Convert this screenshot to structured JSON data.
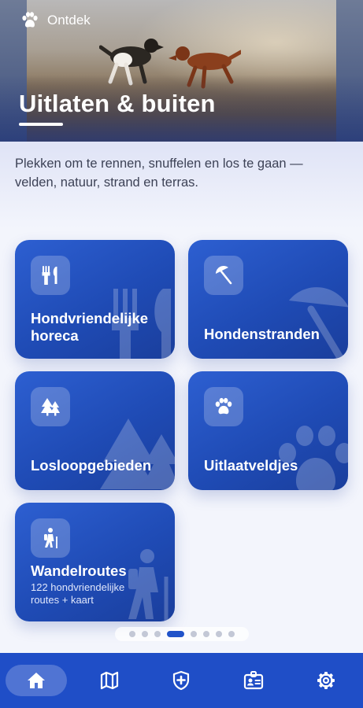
{
  "header": {
    "brand_label": "Ontdek",
    "title": "Uitlaten & buiten",
    "brand_icon": "paw-icon"
  },
  "intro": {
    "text": "Plekken om te rennen, snuffelen en los te gaan — velden, natuur, strand en terras."
  },
  "categories": [
    {
      "label": "Hondvriendelijke horeca",
      "icon": "utensils-icon"
    },
    {
      "label": "Hondenstranden",
      "icon": "beach-umbrella-icon"
    },
    {
      "label": "Losloopgebieden",
      "icon": "trees-icon"
    },
    {
      "label": "Uitlaatveldjes",
      "icon": "paw-icon"
    },
    {
      "label": "Wandelroutes",
      "subtitle": "122 hondvriendelijke routes + kaart",
      "icon": "hiker-icon"
    }
  ],
  "pager": {
    "count": 8,
    "active_index": 3
  },
  "bottom_nav": {
    "items": [
      {
        "icon": "home-icon",
        "active": true
      },
      {
        "icon": "map-icon",
        "active": false
      },
      {
        "icon": "shield-plus-icon",
        "active": false
      },
      {
        "icon": "id-card-icon",
        "active": false
      },
      {
        "icon": "gear-icon",
        "active": false
      }
    ]
  },
  "colors": {
    "primary": "#1f4ec7",
    "card": "#2153c9",
    "background": "#f3f5fc"
  }
}
